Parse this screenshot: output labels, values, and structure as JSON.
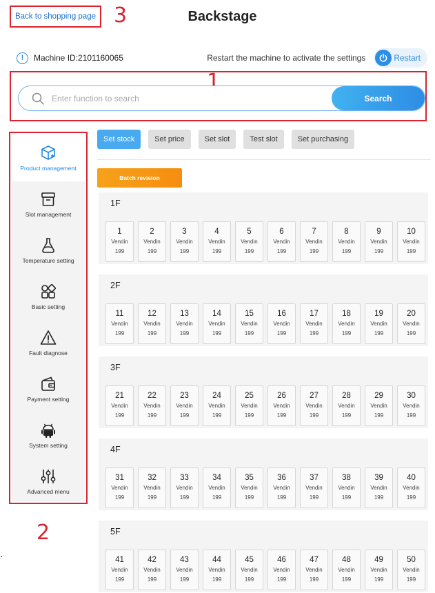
{
  "header": {
    "back_label": "Back to shopping page",
    "title": "Backstage",
    "annotation_3": "3",
    "annotation_1": "1",
    "annotation_2": "2"
  },
  "machine": {
    "id_text": "Machine ID:2101160065",
    "restart_message": "Restart the machine to activate the settings",
    "restart_label": "Restart"
  },
  "search": {
    "placeholder": "Enter function to search",
    "button_label": "Search"
  },
  "sidebar": {
    "items": [
      {
        "label": "Product management",
        "icon": "package-icon"
      },
      {
        "label": "Slot management",
        "icon": "archive-box-icon"
      },
      {
        "label": "Temperature setting",
        "icon": "flask-icon"
      },
      {
        "label": "Basic setting",
        "icon": "grid-icon"
      },
      {
        "label": "Fault diagnose",
        "icon": "warning-icon"
      },
      {
        "label": "Payment setting",
        "icon": "wallet-icon"
      },
      {
        "label": "System setting",
        "icon": "android-icon"
      },
      {
        "label": "Advanced menu",
        "icon": "sliders-icon"
      }
    ]
  },
  "tabs": [
    {
      "label": "Set stock",
      "active": true
    },
    {
      "label": "Set price",
      "active": false
    },
    {
      "label": "Set slot",
      "active": false
    },
    {
      "label": "Test slot",
      "active": false
    },
    {
      "label": "Set purchasing",
      "active": false
    }
  ],
  "batch_label": "Batch revision",
  "floors": [
    {
      "label": "1F",
      "slots": [
        {
          "num": "1",
          "status": "Vendin",
          "stock": "199"
        },
        {
          "num": "2",
          "status": "Vendin",
          "stock": "199"
        },
        {
          "num": "3",
          "status": "Vendin",
          "stock": "199"
        },
        {
          "num": "4",
          "status": "Vendin",
          "stock": "199"
        },
        {
          "num": "5",
          "status": "Vendin",
          "stock": "199"
        },
        {
          "num": "6",
          "status": "Vendin",
          "stock": "199"
        },
        {
          "num": "7",
          "status": "Vendin",
          "stock": "199"
        },
        {
          "num": "8",
          "status": "Vendin",
          "stock": "199"
        },
        {
          "num": "9",
          "status": "Vendin",
          "stock": "199"
        },
        {
          "num": "10",
          "status": "Vendin",
          "stock": "199"
        }
      ]
    },
    {
      "label": "2F",
      "slots": [
        {
          "num": "11",
          "status": "Vendin",
          "stock": "199"
        },
        {
          "num": "12",
          "status": "Vendin",
          "stock": "199"
        },
        {
          "num": "13",
          "status": "Vendin",
          "stock": "199"
        },
        {
          "num": "14",
          "status": "Vendin",
          "stock": "199"
        },
        {
          "num": "15",
          "status": "Vendin",
          "stock": "199"
        },
        {
          "num": "16",
          "status": "Vendin",
          "stock": "199"
        },
        {
          "num": "17",
          "status": "Vendin",
          "stock": "199"
        },
        {
          "num": "18",
          "status": "Vendin",
          "stock": "199"
        },
        {
          "num": "19",
          "status": "Vendin",
          "stock": "199"
        },
        {
          "num": "20",
          "status": "Vendin",
          "stock": "199"
        }
      ]
    },
    {
      "label": "3F",
      "slots": [
        {
          "num": "21",
          "status": "Vendin",
          "stock": "199"
        },
        {
          "num": "22",
          "status": "Vendin",
          "stock": "199"
        },
        {
          "num": "23",
          "status": "Vendin",
          "stock": "199"
        },
        {
          "num": "24",
          "status": "Vendin",
          "stock": "199"
        },
        {
          "num": "25",
          "status": "Vendin",
          "stock": "199"
        },
        {
          "num": "26",
          "status": "Vendin",
          "stock": "199"
        },
        {
          "num": "27",
          "status": "Vendin",
          "stock": "199"
        },
        {
          "num": "28",
          "status": "Vendin",
          "stock": "199"
        },
        {
          "num": "29",
          "status": "Vendin",
          "stock": "199"
        },
        {
          "num": "30",
          "status": "Vendin",
          "stock": "199"
        }
      ]
    },
    {
      "label": "4F",
      "slots": [
        {
          "num": "31",
          "status": "Vendin",
          "stock": "199"
        },
        {
          "num": "32",
          "status": "Vendin",
          "stock": "199"
        },
        {
          "num": "33",
          "status": "Vendin",
          "stock": "199"
        },
        {
          "num": "34",
          "status": "Vendin",
          "stock": "199"
        },
        {
          "num": "35",
          "status": "Vendin",
          "stock": "199"
        },
        {
          "num": "36",
          "status": "Vendin",
          "stock": "199"
        },
        {
          "num": "37",
          "status": "Vendin",
          "stock": "199"
        },
        {
          "num": "38",
          "status": "Vendin",
          "stock": "199"
        },
        {
          "num": "39",
          "status": "Vendin",
          "stock": "199"
        },
        {
          "num": "40",
          "status": "Vendin",
          "stock": "199"
        }
      ]
    },
    {
      "label": "5F",
      "slots": [
        {
          "num": "41",
          "status": "Vendin",
          "stock": "199"
        },
        {
          "num": "42",
          "status": "Vendin",
          "stock": "199"
        },
        {
          "num": "43",
          "status": "Vendin",
          "stock": "199"
        },
        {
          "num": "44",
          "status": "Vendin",
          "stock": "199"
        },
        {
          "num": "45",
          "status": "Vendin",
          "stock": "199"
        },
        {
          "num": "46",
          "status": "Vendin",
          "stock": "199"
        },
        {
          "num": "47",
          "status": "Vendin",
          "stock": "199"
        },
        {
          "num": "48",
          "status": "Vendin",
          "stock": "199"
        },
        {
          "num": "49",
          "status": "Vendin",
          "stock": "199"
        },
        {
          "num": "50",
          "status": "Vendin",
          "stock": "199"
        }
      ]
    }
  ],
  "colors": {
    "accent_blue": "#2b8ee8",
    "active_tab": "#4aaaf0",
    "batch_orange": "#f7a11b",
    "annotation_red": "#d9232e"
  }
}
